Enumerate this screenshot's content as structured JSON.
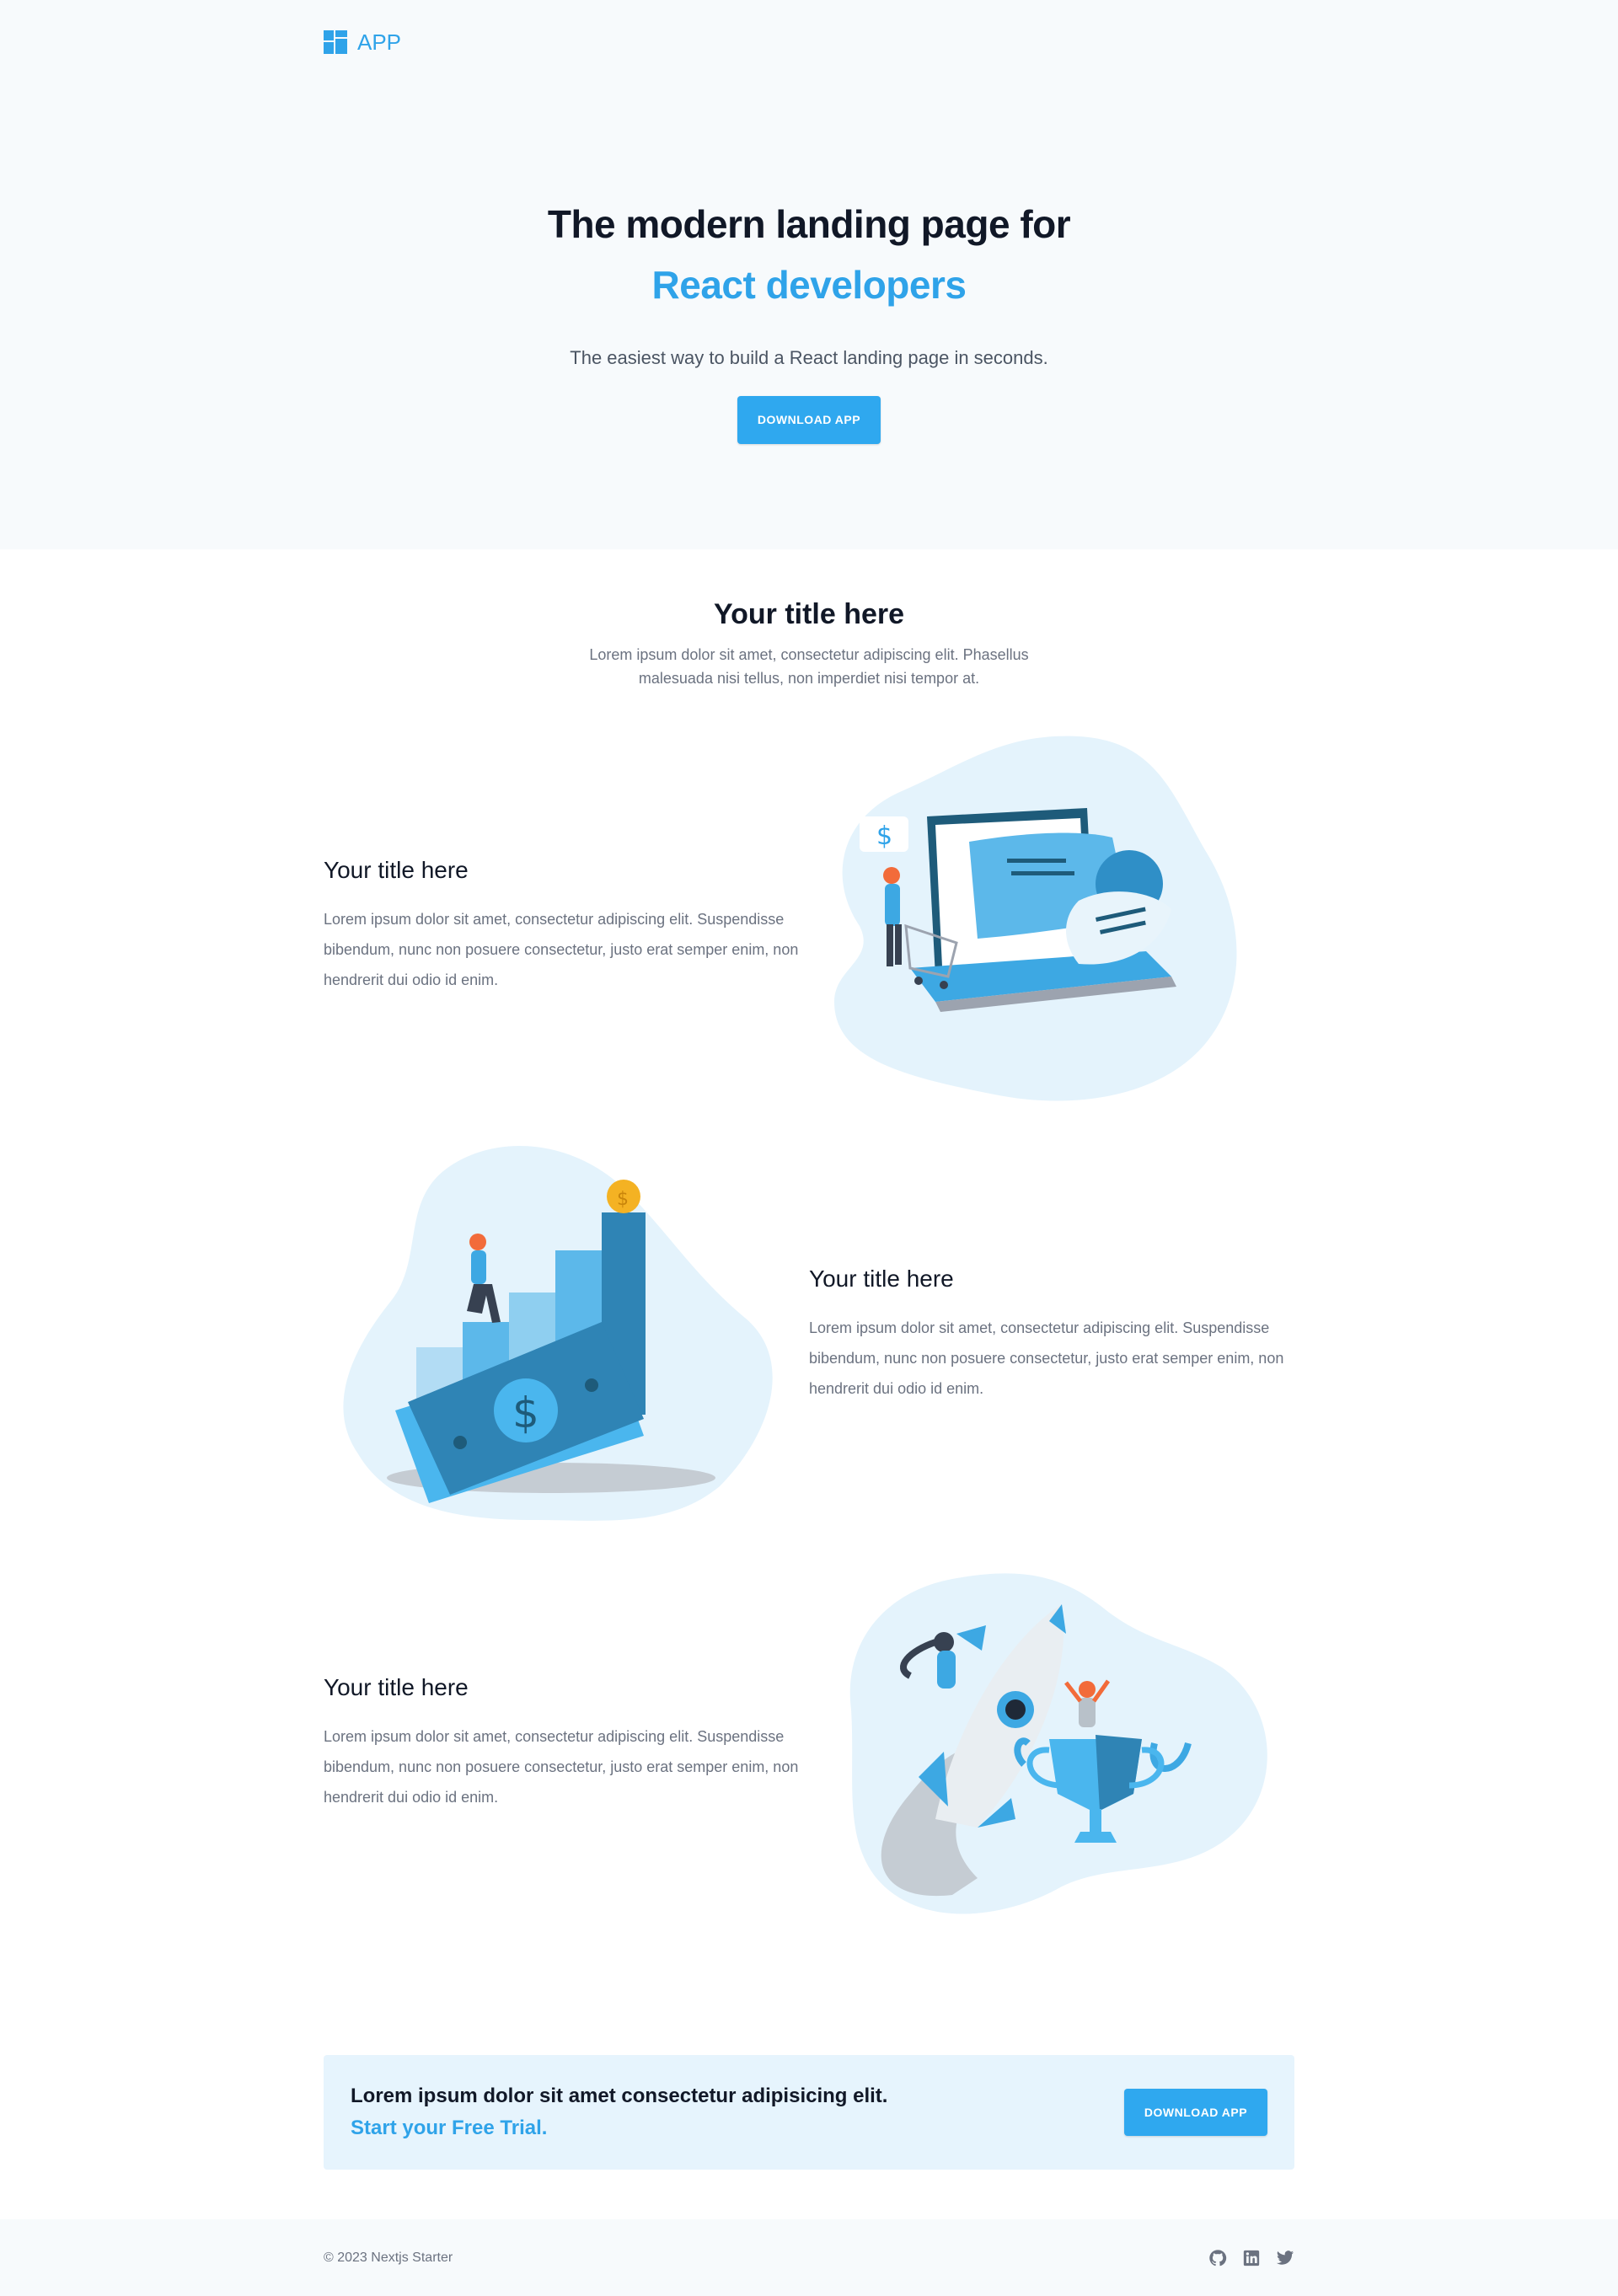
{
  "nav": {
    "logo_text": "APP",
    "logo_icon": "grid-logo-icon"
  },
  "hero": {
    "title_line1": "The modern landing page for",
    "title_line2": "React developers",
    "subtitle": "The easiest way to build a React landing page in seconds.",
    "button_label": "DOWNLOAD APP"
  },
  "features": {
    "title": "Your title here",
    "description": "Lorem ipsum dolor sit amet, consectetur adipiscing elit. Phasellus malesuada nisi tellus, non imperdiet nisi tempor at.",
    "rows": [
      {
        "title": "Your title here",
        "description": "Lorem ipsum dolor sit amet, consectetur adipiscing elit. Suspendisse bibendum, nunc non posuere consectetur, justo erat semper enim, non hendrerit dui odio id enim.",
        "illustration": "online-shopping-illustration"
      },
      {
        "title": "Your title here",
        "description": "Lorem ipsum dolor sit amet, consectetur adipiscing elit. Suspendisse bibendum, nunc non posuere consectetur, justo erat semper enim, non hendrerit dui odio id enim.",
        "illustration": "growing-money-illustration"
      },
      {
        "title": "Your title here",
        "description": "Lorem ipsum dolor sit amet, consectetur adipiscing elit. Suspendisse bibendum, nunc non posuere consectetur, justo erat semper enim, non hendrerit dui odio id enim.",
        "illustration": "rocket-trophy-illustration"
      }
    ]
  },
  "banner": {
    "title": "Lorem ipsum dolor sit amet consectetur adipisicing elit.",
    "subtitle": "Start your Free Trial.",
    "button_label": "DOWNLOAD APP"
  },
  "footer": {
    "copyright": "© 2023 Nextjs Starter",
    "social_icons": [
      "github-icon",
      "linkedin-icon",
      "twitter-icon"
    ]
  },
  "colors": {
    "primary": "#2fa3e9",
    "hero_bg": "#f7fafc",
    "banner_bg": "#e6f4fd",
    "blob": "#e4f3fc"
  }
}
